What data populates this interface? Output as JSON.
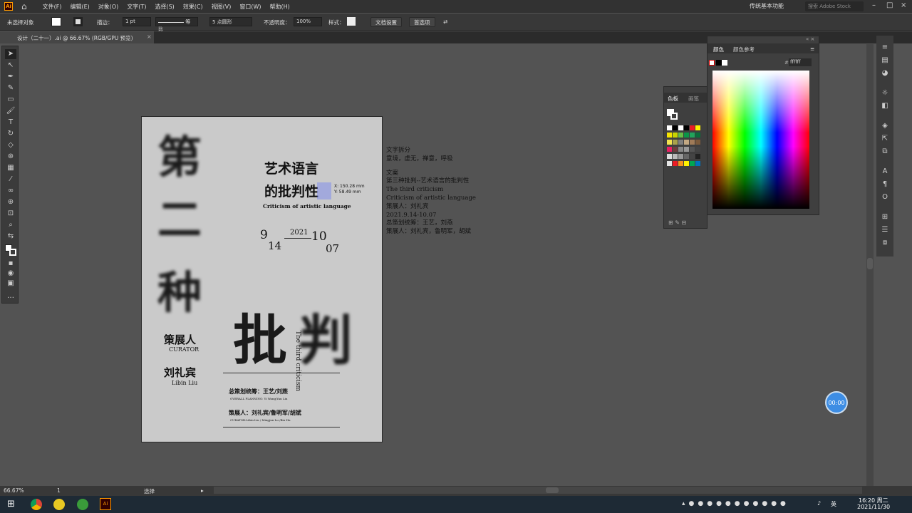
{
  "app": {
    "logo": "Ai",
    "menus": [
      "文件(F)",
      "编辑(E)",
      "对象(O)",
      "文字(T)",
      "选择(S)",
      "效果(C)",
      "视图(V)",
      "窗口(W)",
      "帮助(H)"
    ],
    "workspace": "传统基本功能",
    "search_placeholder": "搜索 Adobe Stock"
  },
  "control_bar": {
    "selection": "未选择对象",
    "stroke_label": "描边：",
    "stroke_value": "1 pt",
    "stroke_style": "等比",
    "brush": "5 点圆形",
    "opacity_label": "不透明度：",
    "opacity_value": "100%",
    "style_label": "样式：",
    "doc_settings": "文档设置",
    "preferences": "首选项"
  },
  "document_tab": {
    "title": "设计（二十一）.ai @ 66.67% (RGB/GPU 预览)"
  },
  "artboard": {
    "big_chars": [
      "第",
      "二",
      "种"
    ],
    "title_line1": "艺术语言",
    "title_line2": "的批判性",
    "subtitle_en": "Criticism of artistic language",
    "measure_x": "X: 150.28 mm",
    "measure_y": "Y: 58.49 mm",
    "year": "2021",
    "date_start_month": "9",
    "date_start_day": "14",
    "date_end_month": "10",
    "date_end_day": "07",
    "curator_cn": "策展人",
    "curator_en": "CURATOR",
    "curator_name_cn": "刘礼宾",
    "curator_name_en": "Libin  Liu",
    "vertical_en": "The third criticism",
    "big_word": [
      "批",
      "判"
    ],
    "planning_line": "总策划统筹：王艺/刘燕",
    "planning_en": "OVERALL PLANNING: Yi Wang/Yan Liu",
    "curators_line": "策展人：刘礼宾/鲁明军/胡斌",
    "curators_en": "CURATOR:Libin Liu / Mingjun Lu /Bin Hu"
  },
  "side_text": [
    "文字拆分",
    "意境，虚无，禅意，呼吸",
    "",
    "文案",
    "第三种批判--艺术语言的批判性",
    "The third criticism",
    "Criticism of artistic language",
    " 策展人：刘礼宾",
    " 2021.9.14-10.07",
    "总策划统筹：王艺，刘燕",
    "策展人：刘礼宾，鲁明军，胡斌"
  ],
  "color_panel": {
    "tab1": "颜色",
    "tab2": "颜色参考",
    "hex": "ffffff"
  },
  "swatches_panel": {
    "tab1": "色板",
    "tab2": "画笔"
  },
  "timer": "00:00",
  "status": {
    "zoom": "66.67%",
    "artboard_num": "1",
    "tool": "选择"
  },
  "taskbar": {
    "time": "16:20 周二",
    "date": "2021/11/30",
    "ime": "英"
  },
  "colors": {
    "ui_dark": "#323232",
    "canvas": "#535353",
    "artboard": "#cacaca",
    "timer": "#3d8de4"
  }
}
